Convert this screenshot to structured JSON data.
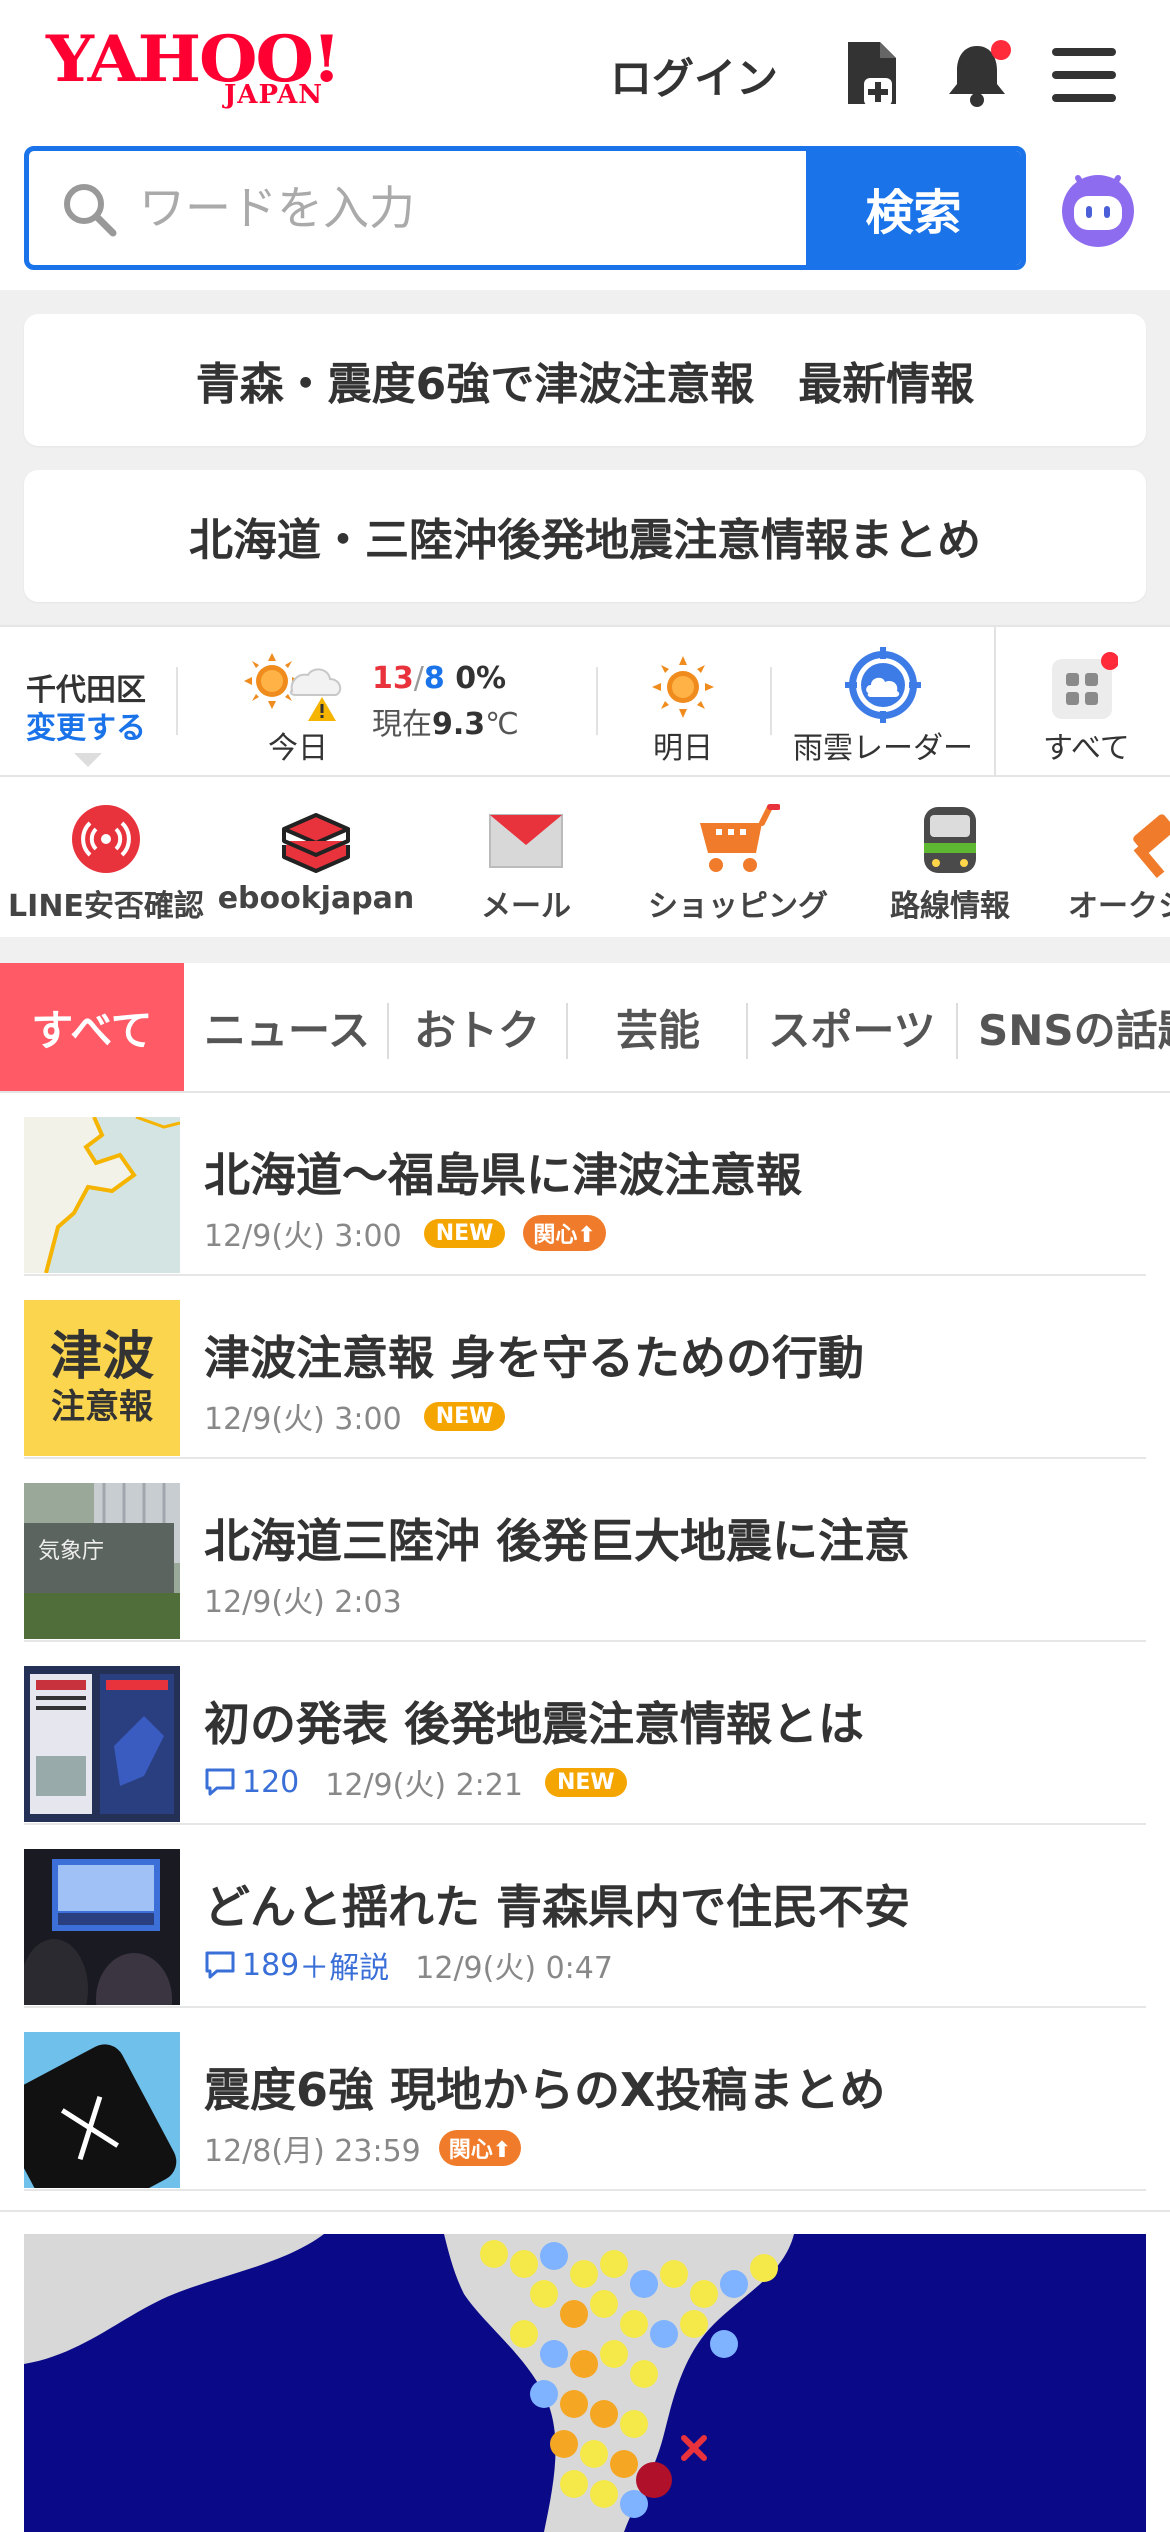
{
  "header": {
    "logo_main": "YAHOO!",
    "logo_sub": "JAPAN",
    "login": "ログイン"
  },
  "search": {
    "placeholder": "ワードを入力",
    "button": "検索"
  },
  "alerts": [
    "青森・震度6強で津波注意報　最新情報",
    "北海道・三陸沖後発地震注意情報まとめ"
  ],
  "weather": {
    "location": "千代田区",
    "change": "変更する",
    "today_label": "今日",
    "high": "13",
    "low": "8",
    "precip": "0%",
    "now_prefix": "現在",
    "now_temp": "9.3",
    "now_unit": "℃",
    "tomorrow_label": "明日",
    "radar_label": "雨雲レーダー",
    "all_label": "すべて"
  },
  "services": [
    {
      "label": "LINE安否確認",
      "icon": "line-safety-icon"
    },
    {
      "label": "ebookjapan",
      "icon": "books-icon"
    },
    {
      "label": "メール",
      "icon": "mail-icon"
    },
    {
      "label": "ショッピング",
      "icon": "cart-icon"
    },
    {
      "label": "路線情報",
      "icon": "train-icon"
    },
    {
      "label": "オークシ",
      "icon": "auction-icon"
    }
  ],
  "tabs": [
    "すべて",
    "ニュース",
    "おトク",
    "芸能",
    "スポーツ",
    "SNSの話題"
  ],
  "news": [
    {
      "title": "北海道〜福島県に津波注意報",
      "time": "12/9(火) 3:00",
      "new": "NEW",
      "kanshin": "関心"
    },
    {
      "title": "津波注意報 身を守るための行動",
      "time": "12/9(火) 3:00",
      "new": "NEW",
      "thumb_top": "津波",
      "thumb_bottom": "注意報"
    },
    {
      "title": "北海道三陸沖 後発巨大地震に注意",
      "time": "12/9(火) 2:03",
      "thumb_sign": "気象庁"
    },
    {
      "title": "初の発表 後発地震注意情報とは",
      "comments": "120",
      "time": "12/9(火) 2:21",
      "new": "NEW"
    },
    {
      "title": "どんと揺れた 青森県内で住民不安",
      "comments": "189",
      "comments_extra": "＋解説",
      "time": "12/9(火) 0:47"
    },
    {
      "title": "震度6強 現地からのX投稿まとめ",
      "time": "12/8(月) 23:59",
      "kanshin": "関心"
    }
  ],
  "colors": {
    "brand_red": "#ff0033",
    "accent_blue": "#1a73e8",
    "tab_active": "#ff5a66",
    "badge_new": "#f5a500",
    "badge_kanshin": "#f07b2a"
  }
}
